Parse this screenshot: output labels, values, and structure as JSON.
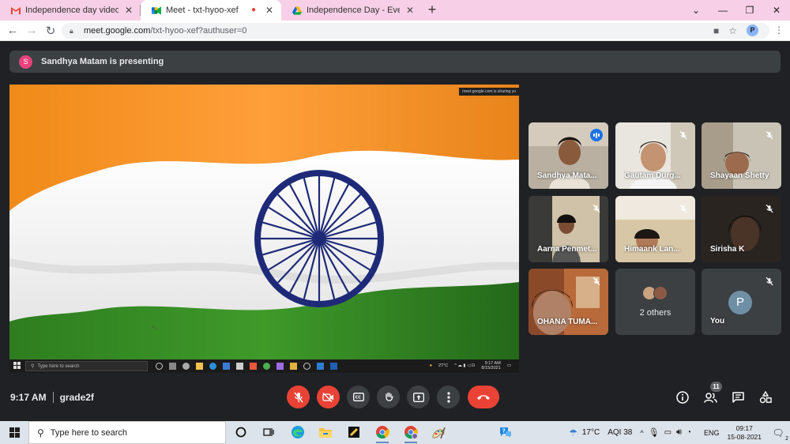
{
  "browser": {
    "tabs": [
      {
        "title": "Independence day video link - p",
        "icon": "gmail-icon",
        "active": false
      },
      {
        "title": "Meet - txt-hyoo-xef",
        "icon": "meet-icon",
        "active": true
      },
      {
        "title": "Independence Day - Event Video",
        "icon": "drive-icon",
        "active": false
      }
    ],
    "url_host": "meet.google.com",
    "url_path": "/txt-hyoo-xef?authuser=0",
    "profile_initial": "P"
  },
  "banner": {
    "avatar_initial": "S",
    "text": "Sandhya Matam is presenting"
  },
  "presentation": {
    "sharing_note": "meet.google.com is sharing yo",
    "mini_search_placeholder": "Type here to search",
    "mini_weather": "27°C",
    "mini_time": "9:17 AM",
    "mini_date": "8/15/2021"
  },
  "participants": [
    {
      "name": "Sandhya Mata...",
      "state": "speaking"
    },
    {
      "name": "Gautam Durg...",
      "state": "muted"
    },
    {
      "name": "Shayaan Shetty",
      "state": "muted"
    },
    {
      "name": "Aarna Penmet...",
      "state": "muted"
    },
    {
      "name": "Himaank Lan...",
      "state": "muted"
    },
    {
      "name": "Sirisha K",
      "state": "muted"
    },
    {
      "name": "OHANA TUMA...",
      "state": "muted"
    },
    {
      "name": "2 others",
      "state": "group"
    },
    {
      "name": "You",
      "state": "muted",
      "avatar_initial": "P"
    }
  ],
  "meeting": {
    "time": "9:17 AM",
    "code": "grade2f",
    "participant_count": "11"
  },
  "taskbar": {
    "search_placeholder": "Type here to search",
    "weather": "17°C",
    "aqi": "AQI 38",
    "language": "ENG",
    "time": "09:17",
    "date": "15-08-2021",
    "notifications": "2"
  },
  "colors": {
    "saffron": "#ff9933",
    "green": "#138808",
    "chakra": "#1e2a78",
    "meet_bg": "#202124",
    "tile_bg": "#3c4043",
    "hangup_red": "#ea4335",
    "active_speaker": "#8ab4f8"
  }
}
